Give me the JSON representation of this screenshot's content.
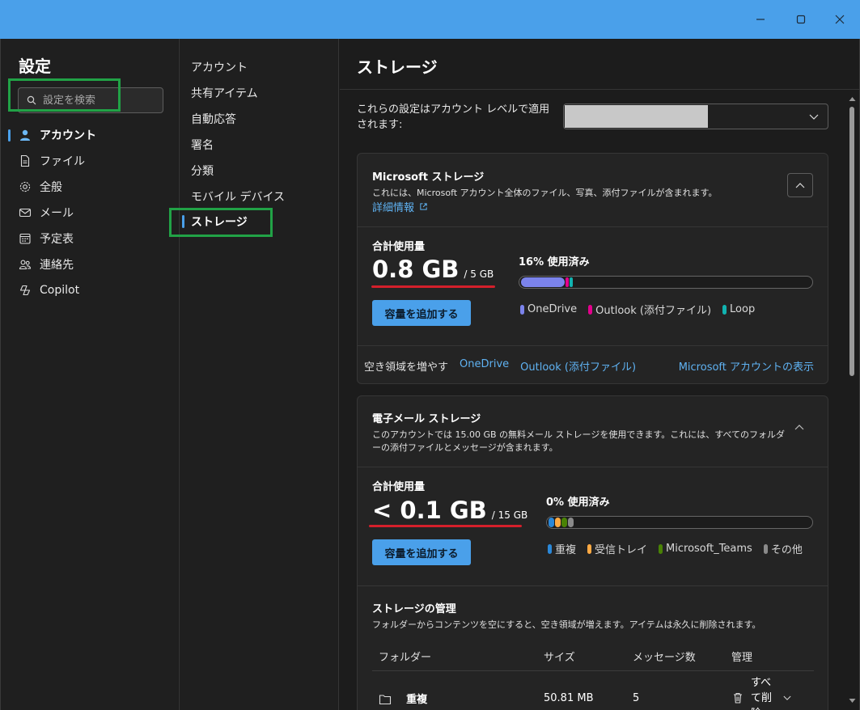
{
  "window": {
    "minimize_icon": "minimize-icon",
    "maximize_icon": "maximize-icon",
    "close_icon": "close-icon"
  },
  "sidebar": {
    "title": "設定",
    "search_placeholder": "設定を検索",
    "items": [
      {
        "label": "アカウント",
        "icon": "person-icon",
        "active": true
      },
      {
        "label": "ファイル",
        "icon": "file-icon"
      },
      {
        "label": "全般",
        "icon": "gear-icon"
      },
      {
        "label": "メール",
        "icon": "mail-icon"
      },
      {
        "label": "予定表",
        "icon": "calendar-icon"
      },
      {
        "label": "連絡先",
        "icon": "people-icon"
      },
      {
        "label": "Copilot",
        "icon": "copilot-icon"
      }
    ]
  },
  "subnav": {
    "items": [
      {
        "label": "アカウント"
      },
      {
        "label": "共有アイテム"
      },
      {
        "label": "自動応答"
      },
      {
        "label": "署名"
      },
      {
        "label": "分類"
      },
      {
        "label": "モバイル デバイス"
      },
      {
        "label": "ストレージ",
        "active": true
      }
    ]
  },
  "main": {
    "title": "ストレージ",
    "apply_text": "これらの設定はアカウント レベルで適用されます:",
    "account_select": {
      "value": ""
    }
  },
  "ms_storage": {
    "title": "Microsoft ストレージ",
    "description": "これには、Microsoft アカウント全体のファイル、写真、添付ファイルが含まれます。",
    "details_link": "詳細情報",
    "total_label": "合計使用量",
    "total_value": "0.8 GB",
    "quota": "/ 5 GB",
    "add_button": "容量を追加する",
    "used_label": "16% 使用済み",
    "used_fraction": 0.16,
    "segments": [
      {
        "name": "OneDrive",
        "color": "#7b83eb",
        "fraction": 0.15
      },
      {
        "name": "Outlook (添付ファイル)",
        "color": "#e3008c",
        "fraction": 0.012
      },
      {
        "name": "Loop",
        "color": "#11b3b0",
        "fraction": 0.01
      }
    ],
    "legend": [
      "OneDrive",
      "Outlook (添付ファイル)",
      "Loop"
    ],
    "free_space_label": "空き領域を増やす",
    "free_links": [
      "OneDrive",
      "Outlook (添付ファイル)"
    ],
    "account_link": "Microsoft アカウントの表示"
  },
  "mail_storage": {
    "title": "電子メール ストレージ",
    "description": "このアカウントでは 15.00 GB の無料メール ストレージを使用できます。これには、すべてのフォルダーの添付ファイルとメッセージが含まれます。",
    "total_label": "合計使用量",
    "total_value": "< 0.1 GB",
    "quota": "/ 15 GB",
    "add_button": "容量を追加する",
    "used_label": "0% 使用済み",
    "used_fraction": 0.004,
    "segments": [
      {
        "name": "重複",
        "color": "#2b88d8",
        "fraction": 0.01
      },
      {
        "name": "受信トレイ",
        "color": "#ffaa44",
        "fraction": 0.01
      },
      {
        "name": "Microsoft_Teams",
        "color": "#498205",
        "fraction": 0.01
      },
      {
        "name": "その他",
        "color": "#8a8a8a",
        "fraction": 0.01
      }
    ],
    "legend": [
      "重複",
      "受信トレイ",
      "Microsoft_Teams",
      "その他"
    ]
  },
  "manage": {
    "title": "ストレージの管理",
    "description": "フォルダーからコンテンツを空にすると、空き領域が増えます。アイテムは永久に削除されます。",
    "columns": [
      "フォルダー",
      "サイズ",
      "メッセージ数",
      "管理"
    ],
    "rows": [
      {
        "folder": "重複",
        "size": "50.81 MB",
        "count": "5",
        "action": "すべて削除"
      }
    ]
  },
  "colors": {
    "accent": "#4aa0ea",
    "highlight_box": "#21a246",
    "underline": "#d41f2b"
  }
}
